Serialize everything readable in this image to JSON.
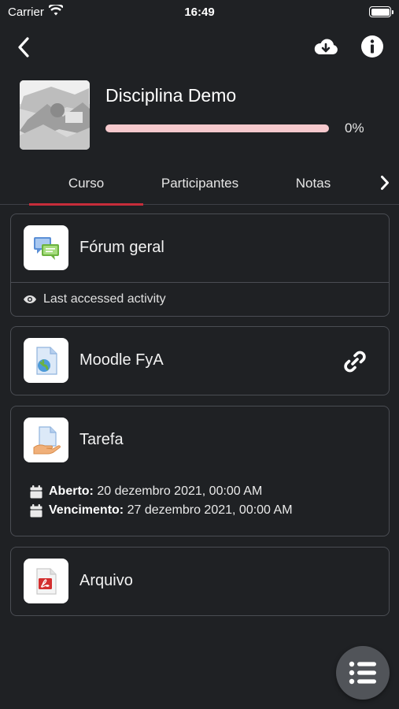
{
  "status_bar": {
    "carrier": "Carrier",
    "time": "16:49"
  },
  "nav": {
    "back_icon": "chevron-left-icon",
    "download_icon": "cloud-download-icon",
    "info_icon": "info-icon"
  },
  "course": {
    "title": "Disciplina Demo",
    "progress_percent": 0,
    "progress_label": "0%",
    "progress_color": "#e33b4a",
    "track_color": "#f6c9cd"
  },
  "tabs": [
    {
      "label": "Curso",
      "active": true
    },
    {
      "label": "Participantes",
      "active": false
    },
    {
      "label": "Notas",
      "active": false
    }
  ],
  "activities": [
    {
      "name": "Fórum geral",
      "icon": "forum-icon",
      "footer": "Last accessed activity"
    },
    {
      "name": "Moodle FyA",
      "icon": "url-globe-icon",
      "action_icon": "link-icon"
    },
    {
      "name": "Tarefa",
      "icon": "assignment-icon",
      "dates": [
        {
          "label": "Aberto:",
          "value": "20 dezembro 2021, 00:00 AM"
        },
        {
          "label": "Vencimento:",
          "value": "27 dezembro 2021, 00:00 AM"
        }
      ]
    },
    {
      "name": "Arquivo",
      "icon": "pdf-file-icon"
    }
  ],
  "colors": {
    "background": "#1f2124",
    "tab_indicator": "#c62d3a",
    "card_border": "#4a4d53",
    "fab": "#515459"
  }
}
